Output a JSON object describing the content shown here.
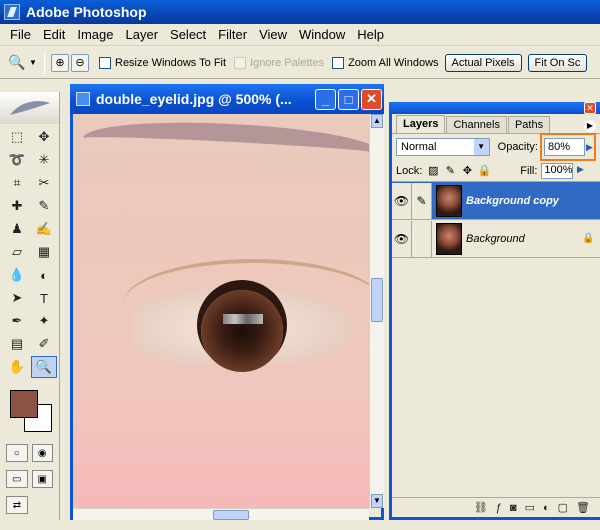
{
  "app": {
    "title": "Adobe Photoshop"
  },
  "menu": [
    "File",
    "Edit",
    "Image",
    "Layer",
    "Select",
    "Filter",
    "View",
    "Window",
    "Help"
  ],
  "options": {
    "resize_windows": "Resize Windows To Fit",
    "ignore_palettes": "Ignore Palettes",
    "zoom_all": "Zoom All Windows",
    "actual_pixels": "Actual Pixels",
    "fit_on_screen": "Fit On Sc"
  },
  "document": {
    "title": "double_eyelid.jpg @ 500% (..."
  },
  "layers_panel": {
    "tabs": [
      "Layers",
      "Channels",
      "Paths"
    ],
    "blend_mode": "Normal",
    "opacity_label": "Opacity:",
    "opacity_value": "80%",
    "lock_label": "Lock:",
    "fill_label": "Fill:",
    "fill_value": "100%",
    "layers": [
      {
        "name": "Background copy"
      },
      {
        "name": "Background"
      }
    ]
  },
  "colors": {
    "foreground": "#8b5343",
    "background": "#ffffff",
    "accent": "#0d55d6",
    "highlight": "#f07a1e"
  }
}
